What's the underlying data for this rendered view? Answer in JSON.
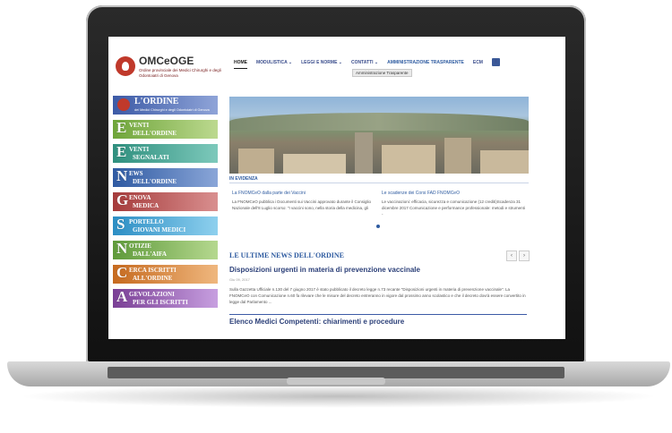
{
  "header": {
    "brand": "OMCeOGE",
    "brand_sub": "Ordine provinciale dei Medici Chirurghi e degli Odontoiatri di Genova",
    "nav": [
      "HOME",
      "MODULISTICA ⌄",
      "LEGGI E NORME ⌄",
      "CONTATTI ⌄",
      "AMMINISTRAZIONE TRASPARENTE",
      "ECM"
    ],
    "fb": "f",
    "submenu": "Amministrazione Trasparente"
  },
  "sidebar": [
    {
      "cap": "",
      "t1": "L'ORDINE",
      "t2": "",
      "t3": "dei Medici Chirurghi e degli Odontoiatri di Genova"
    },
    {
      "cap": "E",
      "t1": "VENTI",
      "t2": "DELL'ORDINE"
    },
    {
      "cap": "E",
      "t1": "VENTI",
      "t2": "SEGNALATI"
    },
    {
      "cap": "N",
      "t1": "EWS",
      "t2": "DELL'ORDINE"
    },
    {
      "cap": "G",
      "t1": "ENOVA",
      "t2": "MEDICA"
    },
    {
      "cap": "S",
      "t1": "PORTELLO",
      "t2": "GIOVANI MEDICI"
    },
    {
      "cap": "N",
      "t1": "OTIZIE",
      "t2": "DALL'AIFA"
    },
    {
      "cap": "C",
      "t1": "ERCA ISCRITTI",
      "t2": "ALL'ORDINE"
    },
    {
      "cap": "A",
      "t1": "GEVOLAZIONI",
      "t2": "PER GLI ISCRITTI"
    }
  ],
  "evidenza": {
    "label": "IN EVIDENZA",
    "left_title": "La FNOMCeO dalla parte dei Vaccini",
    "left_text": "La FNOMCeO pubblica i Documenti sui Vaccini approvato durante il Consiglio Nazionale dell'8 Luglio scorso: \"I vaccini sono, nella storia della medicina, gli",
    "right_title": "Le scadenze dei Corsi FAD FNOMCeO",
    "right_text": "Le vaccinazioni: efficacia, sicurezza e comunicazione (12 crediti)Scadenza 31 dicembre 2017 Comunicazione e performance professionale: metodi e strumenti -"
  },
  "news": {
    "heading": "LE ULTIME NEWS DELL'ORDINE",
    "prev": "‹",
    "next": "›",
    "title": "Disposizioni urgenti in materia di prevenzione vaccinale",
    "date": "Giu 09, 2017",
    "body": "Sulla Gazzetta Ufficiale n.130 del 7 giugno 2017 è stato pubblicato il decreto legge n.73 recante \"Disposizioni urgenti in materia di prevenzione vaccinale\". La FNOMCeO con Comunicazione n.60 fa rilevare che le misure del decreto entreranno in vigore dal prossimo anno scolastico e che il decreto dovrà essere convertito in legge dal Parlamento ...",
    "title2": "Elenco Medici Competenti: chiarimenti e procedure"
  }
}
